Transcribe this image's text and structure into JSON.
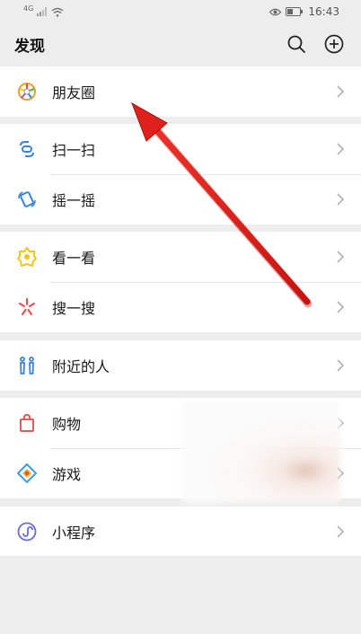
{
  "status_bar": {
    "network": "4G",
    "time": "16:43"
  },
  "header": {
    "title": "发现",
    "search_icon": "search-icon",
    "add_icon": "plus-circle-icon"
  },
  "groups": [
    [
      {
        "label": "朋友圈",
        "icon": "moments-icon",
        "color": "#f0a020"
      }
    ],
    [
      {
        "label": "扫一扫",
        "icon": "scan-icon",
        "color": "#3a84d8"
      },
      {
        "label": "摇一摇",
        "icon": "shake-icon",
        "color": "#3a84d8"
      }
    ],
    [
      {
        "label": "看一看",
        "icon": "top-stories-icon",
        "color": "#f5c518"
      },
      {
        "label": "搜一搜",
        "icon": "search-spark-icon",
        "color": "#e84a4a"
      }
    ],
    [
      {
        "label": "附近的人",
        "icon": "people-nearby-icon",
        "color": "#3a84d8"
      }
    ],
    [
      {
        "label": "购物",
        "icon": "shopping-bag-icon",
        "color": "#e85a5a"
      },
      {
        "label": "游戏",
        "icon": "game-icon",
        "color": "#3a9fd8"
      }
    ],
    [
      {
        "label": "小程序",
        "icon": "mini-program-icon",
        "color": "#6a6ad8"
      }
    ]
  ],
  "colors": {
    "background": "#ededed",
    "annotation_arrow": "#e0201a"
  }
}
